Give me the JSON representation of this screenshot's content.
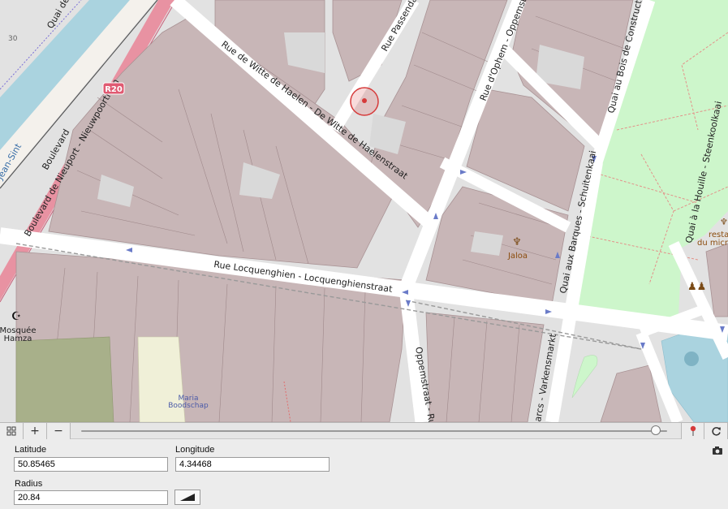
{
  "map": {
    "streets": [
      "Rue de Witte de Haelen - De Witte de Haelenstraat",
      "Rue Locquenghien - Locquenghienstraat",
      "Rue d'Ophem - Oppemstraat",
      "Quai au Bois de Construction",
      "Quai aux Barques - Schuitenkaai",
      "Boulevard de Nieuport - Nieuwpoortlaan",
      "Boulevard",
      "Rue Passendal",
      "Oppemstraat - Rue",
      "Quai à la Houille - Steenkoolkaai",
      "arcs - Varkensmarkt",
      "Quai de",
      "Jean-Sint"
    ],
    "road_ref": "R20",
    "house_number": "30",
    "pois": {
      "jaloa": "Jaloa",
      "restaurant_1": "resta",
      "restaurant_2": "du micr",
      "mosque_1": "Mosquée",
      "mosque_2": "Hamza",
      "school_1": "Maria",
      "school_2": "Boodschap"
    },
    "marker_icon": "location-pin-circle"
  },
  "toolbar": {
    "grid_icon": "grid-icon",
    "zoom_in": "+",
    "zoom_out": "−",
    "zoom_level": 0.98,
    "pin_icon": "pin-icon",
    "refresh_icon": "refresh-icon"
  },
  "form": {
    "latitude_label": "Latitude",
    "latitude_value": "50.85465",
    "longitude_label": "Longitude",
    "longitude_value": "4.34468",
    "radius_label": "Radius",
    "radius_value": "20.84",
    "radius_shape_icon": "wedge-icon",
    "camera_icon": "camera-icon"
  },
  "colors": {
    "building": "#c8b6b7",
    "building_stroke": "#a89294",
    "road": "#ffffff",
    "land": "#e2e2e2",
    "park": "#cdf6cb",
    "trunk_road": "#e892a2",
    "water": "#aad3df",
    "marker": "#d63a3a"
  }
}
